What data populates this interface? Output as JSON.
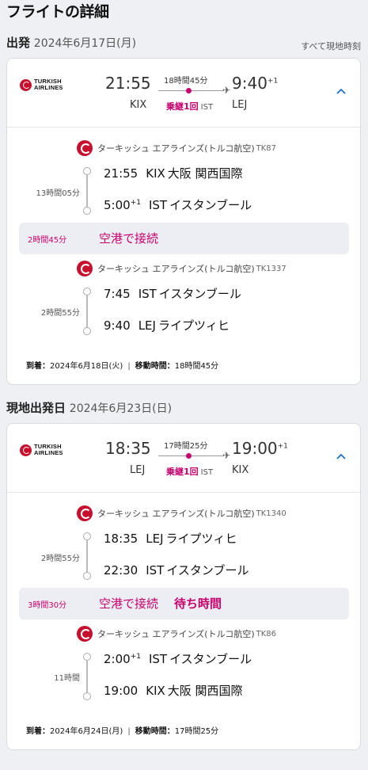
{
  "page_title": "フライトの詳細",
  "timezone_note": "すべて現地時刻",
  "airline_logo_text": [
    "TURKISH",
    "AIRLINES"
  ],
  "outbound": {
    "header_label": "出発",
    "header_date": "2024年6月17日(月)",
    "summary": {
      "dep_time": "21:55",
      "dep_code": "KIX",
      "arr_time": "9:40",
      "arr_plus": "+1",
      "arr_code": "LEJ",
      "duration": "18時間45分",
      "stops": "乗継1回",
      "via": "IST"
    },
    "segments": [
      {
        "airline": "ターキッシュ エアラインズ(トルコ航空)",
        "flight": "TK87",
        "duration": "13時間05分",
        "dep_time": "21:55",
        "dep_plus": "",
        "dep_code": "KIX",
        "dep_name": "大阪 関西国際",
        "arr_time": "5:00",
        "arr_plus": "+1",
        "arr_code": "IST",
        "arr_name": "イスタンブール"
      },
      {
        "airline": "ターキッシュ エアラインズ(トルコ航空)",
        "flight": "TK1337",
        "duration": "2時間55分",
        "dep_time": "7:45",
        "dep_plus": "",
        "dep_code": "IST",
        "dep_name": "イスタンブール",
        "arr_time": "9:40",
        "arr_plus": "",
        "arr_code": "LEJ",
        "arr_name": "ライプツィヒ"
      }
    ],
    "layover": {
      "duration": "2時間45分",
      "text": "空港で接続",
      "wait": ""
    },
    "arrival": {
      "label": "到着：",
      "date": "2024年6月18日(火)",
      "sep": "|",
      "travel_label": "移動時間：",
      "travel_time": "18時間45分"
    }
  },
  "return": {
    "header_label": "現地出発日",
    "header_date": "2024年6月23日(日)",
    "summary": {
      "dep_time": "18:35",
      "dep_code": "LEJ",
      "arr_time": "19:00",
      "arr_plus": "+1",
      "arr_code": "KIX",
      "duration": "17時間25分",
      "stops": "乗継1回",
      "via": "IST"
    },
    "segments": [
      {
        "airline": "ターキッシュ エアラインズ(トルコ航空)",
        "flight": "TK1340",
        "duration": "2時間55分",
        "dep_time": "18:35",
        "dep_plus": "",
        "dep_code": "LEJ",
        "dep_name": "ライプツィヒ",
        "arr_time": "22:30",
        "arr_plus": "",
        "arr_code": "IST",
        "arr_name": "イスタンブール"
      },
      {
        "airline": "ターキッシュ エアラインズ(トルコ航空)",
        "flight": "TK86",
        "duration": "11時間",
        "dep_time": "2:00",
        "dep_plus": "+1",
        "dep_code": "IST",
        "dep_name": "イスタンブール",
        "arr_time": "19:00",
        "arr_plus": "",
        "arr_code": "KIX",
        "arr_name": "大阪 関西国際"
      }
    ],
    "layover": {
      "duration": "3時間30分",
      "text": "空港で接続",
      "wait": "待ち時間"
    },
    "arrival": {
      "label": "到着：",
      "date": "2024年6月24日(月)",
      "sep": "|",
      "travel_label": "移動時間：",
      "travel_time": "17時間25分"
    }
  },
  "colors": {
    "accent_magenta": "#c8006e",
    "airline_red": "#c8102e",
    "chevron_blue": "#1a73c8"
  }
}
